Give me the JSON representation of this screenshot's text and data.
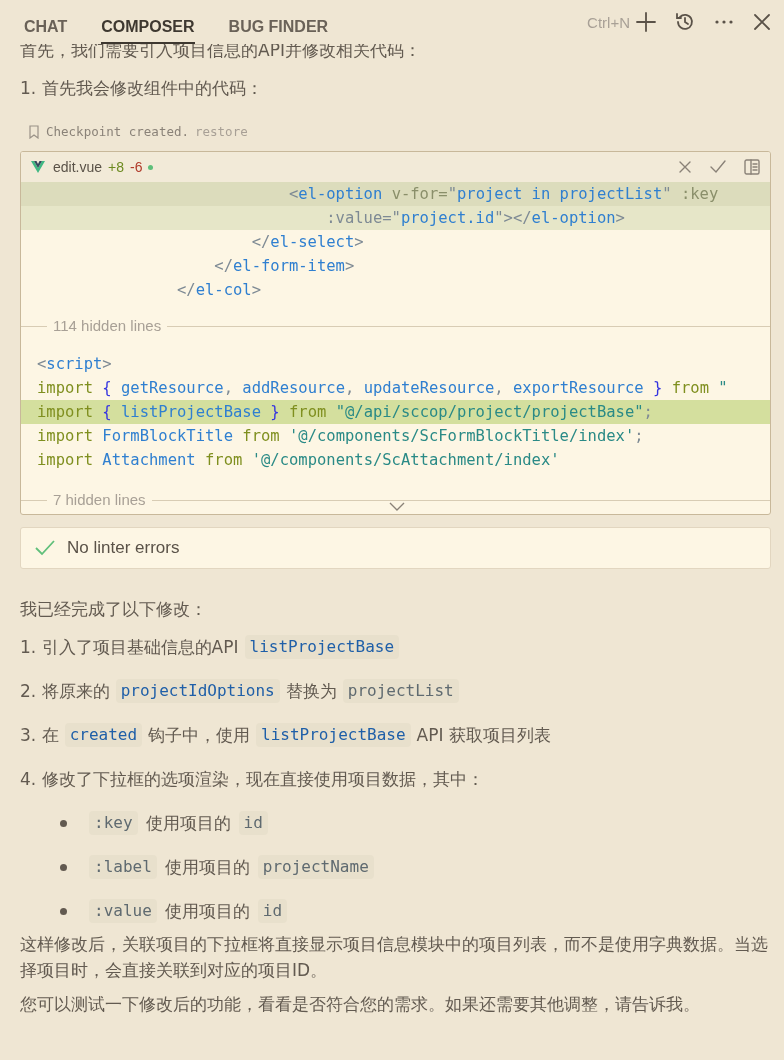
{
  "tabs": [
    {
      "label": "CHAT",
      "selected": false
    },
    {
      "label": "COMPOSER",
      "selected": true
    },
    {
      "label": "BUG FINDER",
      "selected": false
    }
  ],
  "toolbar": {
    "shortcut": "Ctrl+N"
  },
  "intro": [
    "首先，我们需要引入项目信息的API并修改相关代码：",
    "1. 首先我会修改组件中的代码："
  ],
  "checkpoint": {
    "text": "Checkpoint created.",
    "action": "restore"
  },
  "editor": {
    "file": "edit.vue",
    "added": "+8",
    "removed": "-6",
    "blocks": [
      {
        "kind": "code",
        "lines": [
          {
            "added": true,
            "tokens": [
              {
                "kind": "punct",
                "t": "                           <"
              },
              {
                "kind": "tag",
                "t": "el-option"
              },
              {
                "kind": "attribute",
                "t": " v-for="
              },
              {
                "kind": "punct",
                "t": "\""
              },
              {
                "kind": "identifier",
                "t": "project in projectList"
              },
              {
                "kind": "punct",
                "t": "\""
              },
              {
                "kind": "attribute",
                "t": " :key"
              }
            ]
          },
          {
            "added": true,
            "tokens": [
              {
                "kind": "punct",
                "t": "                               :value="
              },
              {
                "kind": "punct",
                "t": "\""
              },
              {
                "kind": "identifier",
                "t": "project.id"
              },
              {
                "kind": "punct",
                "t": "\"></"
              },
              {
                "kind": "tag",
                "t": "el-option"
              },
              {
                "kind": "punct",
                "t": ">"
              }
            ]
          },
          {
            "added": false,
            "tokens": [
              {
                "kind": "punct",
                "t": "                       </"
              },
              {
                "kind": "tag",
                "t": "el-select"
              },
              {
                "kind": "punct",
                "t": ">"
              }
            ]
          },
          {
            "added": false,
            "tokens": [
              {
                "kind": "punct",
                "t": "                   </"
              },
              {
                "kind": "tag",
                "t": "el-form-item"
              },
              {
                "kind": "punct",
                "t": ">"
              }
            ]
          },
          {
            "added": false,
            "tokens": [
              {
                "kind": "punct",
                "t": "               </"
              },
              {
                "kind": "tag",
                "t": "el-col"
              },
              {
                "kind": "punct",
                "t": ">"
              }
            ]
          }
        ]
      },
      {
        "kind": "hidden",
        "label": "114 hidden lines"
      },
      {
        "kind": "code",
        "lines": [
          {
            "added": false,
            "tokens": [
              {
                "kind": "punct",
                "t": "<"
              },
              {
                "kind": "tag",
                "t": "script"
              },
              {
                "kind": "punct",
                "t": ">"
              }
            ]
          },
          {
            "added": false,
            "tokens": [
              {
                "kind": "keyword",
                "t": "import"
              },
              {
                "kind": "brace",
                "t": " { "
              },
              {
                "kind": "identifier",
                "t": "getResource"
              },
              {
                "kind": "punct",
                "t": ", "
              },
              {
                "kind": "identifier",
                "t": "addResource"
              },
              {
                "kind": "punct",
                "t": ", "
              },
              {
                "kind": "identifier",
                "t": "updateResource"
              },
              {
                "kind": "punct",
                "t": ", "
              },
              {
                "kind": "identifier",
                "t": "exportResource"
              },
              {
                "kind": "brace",
                "t": " } "
              },
              {
                "kind": "keyword",
                "t": "from"
              },
              {
                "kind": "string",
                "t": " \""
              }
            ]
          },
          {
            "added": true,
            "tokens": [
              {
                "kind": "keyword",
                "t": "import"
              },
              {
                "kind": "brace",
                "t": " { "
              },
              {
                "kind": "identifier",
                "t": "listProjectBase"
              },
              {
                "kind": "brace",
                "t": " } "
              },
              {
                "kind": "keyword",
                "t": "from"
              },
              {
                "kind": "string",
                "t": " \"@/api/sccop/project/projectBase\""
              },
              {
                "kind": "punct",
                "t": ";"
              }
            ]
          },
          {
            "added": false,
            "tokens": [
              {
                "kind": "keyword",
                "t": "import"
              },
              {
                "kind": "identifier",
                "t": " FormBlockTitle "
              },
              {
                "kind": "keyword",
                "t": "from"
              },
              {
                "kind": "string",
                "t": " '@/components/ScFormBlockTitle/index'"
              },
              {
                "kind": "punct",
                "t": ";"
              }
            ]
          },
          {
            "added": false,
            "tokens": [
              {
                "kind": "keyword",
                "t": "import"
              },
              {
                "kind": "identifier",
                "t": " Attachment "
              },
              {
                "kind": "keyword",
                "t": "from"
              },
              {
                "kind": "string",
                "t": " '@/components/ScAttachment/index'"
              }
            ]
          }
        ]
      },
      {
        "kind": "hidden",
        "label": "7 hidden lines"
      }
    ]
  },
  "linter": {
    "ok": true,
    "text": "No linter errors"
  },
  "summary": [
    {
      "kind": "para",
      "parts": [
        {
          "kind": "text",
          "t": "我已经完成了以下修改："
        }
      ]
    },
    {
      "kind": "para",
      "parts": [
        {
          "kind": "text",
          "t": "1. 引入了项目基础信息的API"
        },
        {
          "kind": "symbol",
          "t": "listProjectBase"
        }
      ]
    },
    {
      "kind": "para",
      "parts": [
        {
          "kind": "text",
          "t": "2. 将原来的"
        },
        {
          "kind": "symbol",
          "t": "projectIdOptions"
        },
        {
          "kind": "text",
          "t": "替换为"
        },
        {
          "kind": "code",
          "t": "projectList"
        }
      ]
    },
    {
      "kind": "para",
      "parts": [
        {
          "kind": "text",
          "t": "3. 在"
        },
        {
          "kind": "symbol",
          "t": "created"
        },
        {
          "kind": "text",
          "t": "钩子中，使用"
        },
        {
          "kind": "symbol",
          "t": "listProjectBase"
        },
        {
          "kind": "text",
          "t": "API 获取项目列表"
        }
      ]
    },
    {
      "kind": "para",
      "parts": [
        {
          "kind": "text",
          "t": "4. 修改了下拉框的选项渲染，现在直接使用项目数据，其中："
        }
      ]
    },
    {
      "kind": "bullet",
      "parts": [
        {
          "kind": "code",
          "t": ":key"
        },
        {
          "kind": "text",
          "t": "使用项目的"
        },
        {
          "kind": "code",
          "t": "id"
        }
      ]
    },
    {
      "kind": "bullet",
      "parts": [
        {
          "kind": "code",
          "t": ":label"
        },
        {
          "kind": "text",
          "t": "使用项目的"
        },
        {
          "kind": "code",
          "t": "projectName"
        }
      ]
    },
    {
      "kind": "bullet",
      "parts": [
        {
          "kind": "code",
          "t": ":value"
        },
        {
          "kind": "text",
          "t": "使用项目的"
        },
        {
          "kind": "code",
          "t": "id"
        }
      ]
    },
    {
      "kind": "para",
      "parts": [
        {
          "kind": "text",
          "t": "这样修改后，关联项目的下拉框将直接显示项目信息模块中的项目列表，而不是使用字典数据。当选择项目时，会直接关联到对应的项目ID。"
        }
      ]
    },
    {
      "kind": "para",
      "parts": [
        {
          "kind": "text",
          "t": "您可以测试一下修改后的功能，看看是否符合您的需求。如果还需要其他调整，请告诉我。"
        }
      ]
    }
  ]
}
